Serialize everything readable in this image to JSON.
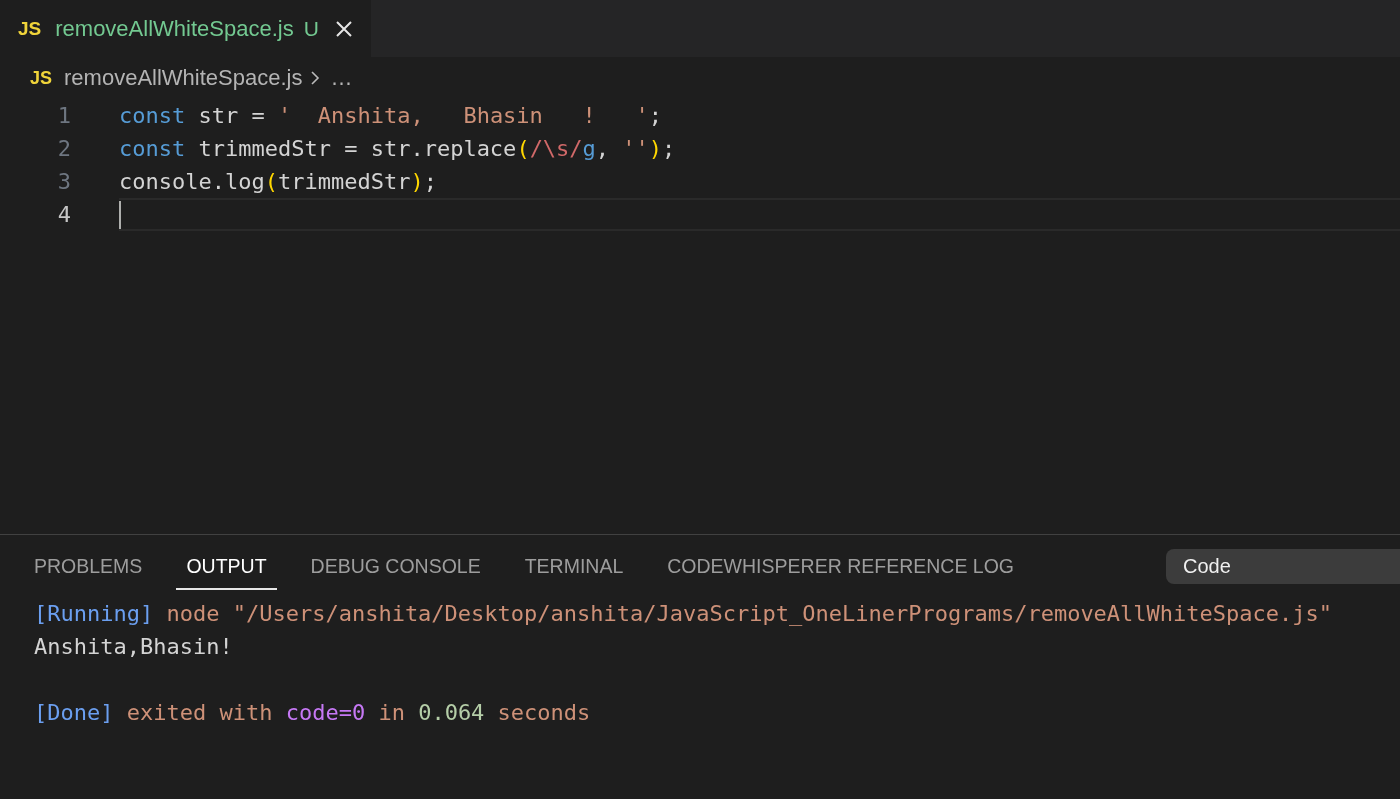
{
  "tabs": [
    {
      "icon_text": "JS",
      "label": "removeAllWhiteSpace.js",
      "badge": "U",
      "selected": true
    }
  ],
  "breadcrumb": {
    "icon_text": "JS",
    "file": "removeAllWhiteSpace.js",
    "more": "…"
  },
  "editor": {
    "lines": [
      {
        "number": "1",
        "current": false,
        "tokens": [
          {
            "t": "const",
            "kind": "keyword"
          },
          {
            "t": " str = ",
            "kind": "plain"
          },
          {
            "t": "'  Anshita,   Bhasin   !   '",
            "kind": "string"
          },
          {
            "t": ";",
            "kind": "plain"
          }
        ]
      },
      {
        "number": "2",
        "current": false,
        "tokens": [
          {
            "t": "const",
            "kind": "keyword"
          },
          {
            "t": " trimmedStr = str.replace",
            "kind": "plain"
          },
          {
            "t": "(",
            "kind": "bracket"
          },
          {
            "t": "/\\s/",
            "kind": "regex"
          },
          {
            "t": "g",
            "kind": "keyword"
          },
          {
            "t": ", ",
            "kind": "plain"
          },
          {
            "t": "''",
            "kind": "string"
          },
          {
            "t": ")",
            "kind": "bracket"
          },
          {
            "t": ";",
            "kind": "plain"
          }
        ]
      },
      {
        "number": "3",
        "current": false,
        "tokens": [
          {
            "t": "console.log",
            "kind": "plain"
          },
          {
            "t": "(",
            "kind": "bracket"
          },
          {
            "t": "trimmedStr",
            "kind": "plain"
          },
          {
            "t": ")",
            "kind": "bracket"
          },
          {
            "t": ";",
            "kind": "plain"
          }
        ]
      },
      {
        "number": "4",
        "current": true
      }
    ]
  },
  "panel": {
    "tabs": [
      {
        "label": "PROBLEMS",
        "selected": false
      },
      {
        "label": "OUTPUT",
        "selected": true
      },
      {
        "label": "DEBUG CONSOLE",
        "selected": false
      },
      {
        "label": "TERMINAL",
        "selected": false
      },
      {
        "label": "CODEWHISPERER REFERENCE LOG",
        "selected": false
      }
    ],
    "channel_select": {
      "value": "Code"
    },
    "output": [
      {
        "kind": "text",
        "tokens": [
          {
            "t": "[Running]",
            "kind": "tag"
          },
          {
            "t": " node \"/Users/anshita/Desktop/anshita/JavaScript_OneLinerPrograms/removeAllWhiteSpace.js\"",
            "kind": "string"
          }
        ]
      },
      {
        "kind": "text",
        "tokens": [
          {
            "t": "Anshita,Bhasin!",
            "kind": "plain"
          }
        ]
      },
      {
        "kind": "blank"
      },
      {
        "kind": "text",
        "tokens": [
          {
            "t": "[Done]",
            "kind": "tag"
          },
          {
            "t": " exited with ",
            "kind": "string"
          },
          {
            "t": "code=0",
            "kind": "purple"
          },
          {
            "t": " in ",
            "kind": "string"
          },
          {
            "t": "0.064",
            "kind": "number"
          },
          {
            "t": " seconds",
            "kind": "string"
          }
        ]
      }
    ]
  }
}
